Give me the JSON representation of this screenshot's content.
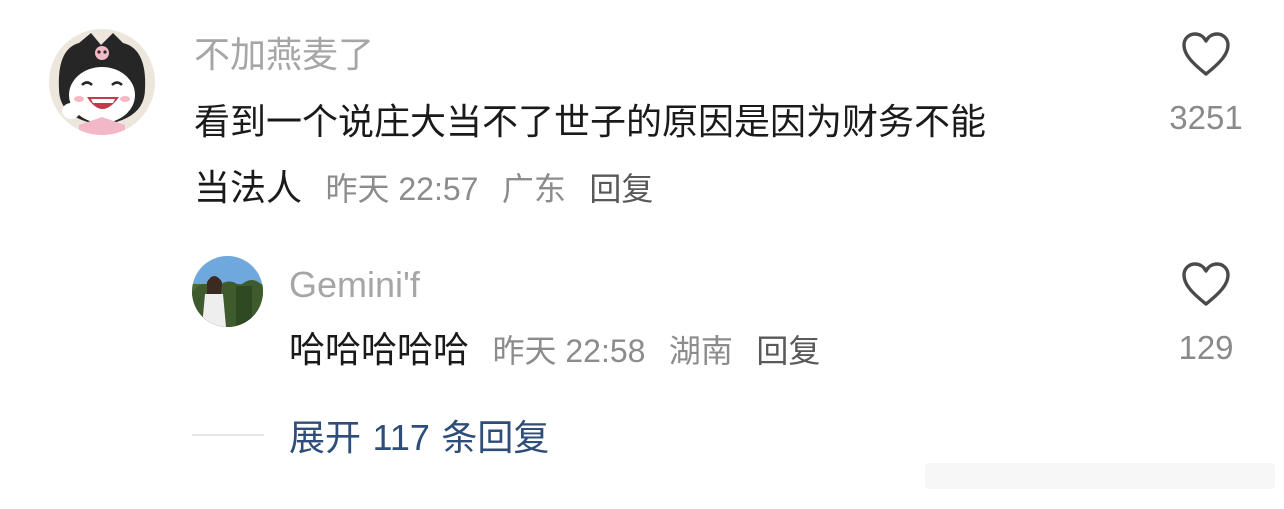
{
  "main_comment": {
    "username": "不加燕麦了",
    "text_line1": "看到一个说庄大当不了世子的原因是因为财务不能",
    "text_line2": "当法人",
    "time": "昨天 22:57",
    "location": "广东",
    "reply_label": "回复",
    "like_count": "3251",
    "avatar_icon": "kuromi-avatar"
  },
  "reply_comment": {
    "username": "Gemini'f",
    "text": "哈哈哈哈哈",
    "time": "昨天 22:58",
    "location": "湖南",
    "reply_label": "回复",
    "like_count": "129",
    "avatar_icon": "photo-avatar"
  },
  "expand": {
    "prefix": "展开",
    "count": "117",
    "suffix": "条回复"
  },
  "colors": {
    "username": "#a6a6a6",
    "text": "#1a1a1a",
    "meta": "#8c8c8c",
    "link": "#2f4d79",
    "like": "#8a8a8a"
  }
}
